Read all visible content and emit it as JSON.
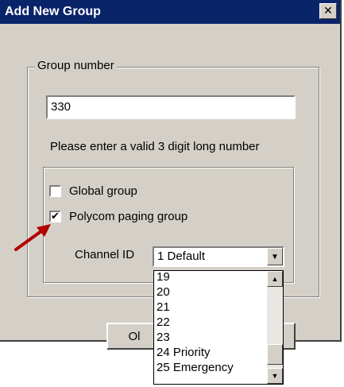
{
  "window": {
    "title": "Add New Group",
    "close_glyph": "✕"
  },
  "group_number": {
    "legend": "Group number",
    "value": "330",
    "hint": "Please enter a valid 3 digit long number"
  },
  "options": {
    "global_group": {
      "label": "Global group",
      "checked": false
    },
    "polycom_paging": {
      "label": "Polycom paging group",
      "checked": true,
      "check_glyph": "✔"
    }
  },
  "channel": {
    "label": "Channel ID",
    "selected": "1 Default",
    "dropdown_items": [
      "19",
      "20",
      "21",
      "22",
      "23",
      "24 Priority",
      "25 Emergency"
    ]
  },
  "buttons": {
    "ok_partial": "Ol"
  },
  "colors": {
    "title_bar": "#0a246a",
    "face": "#d4d0c8",
    "arrow": "#b00000"
  }
}
